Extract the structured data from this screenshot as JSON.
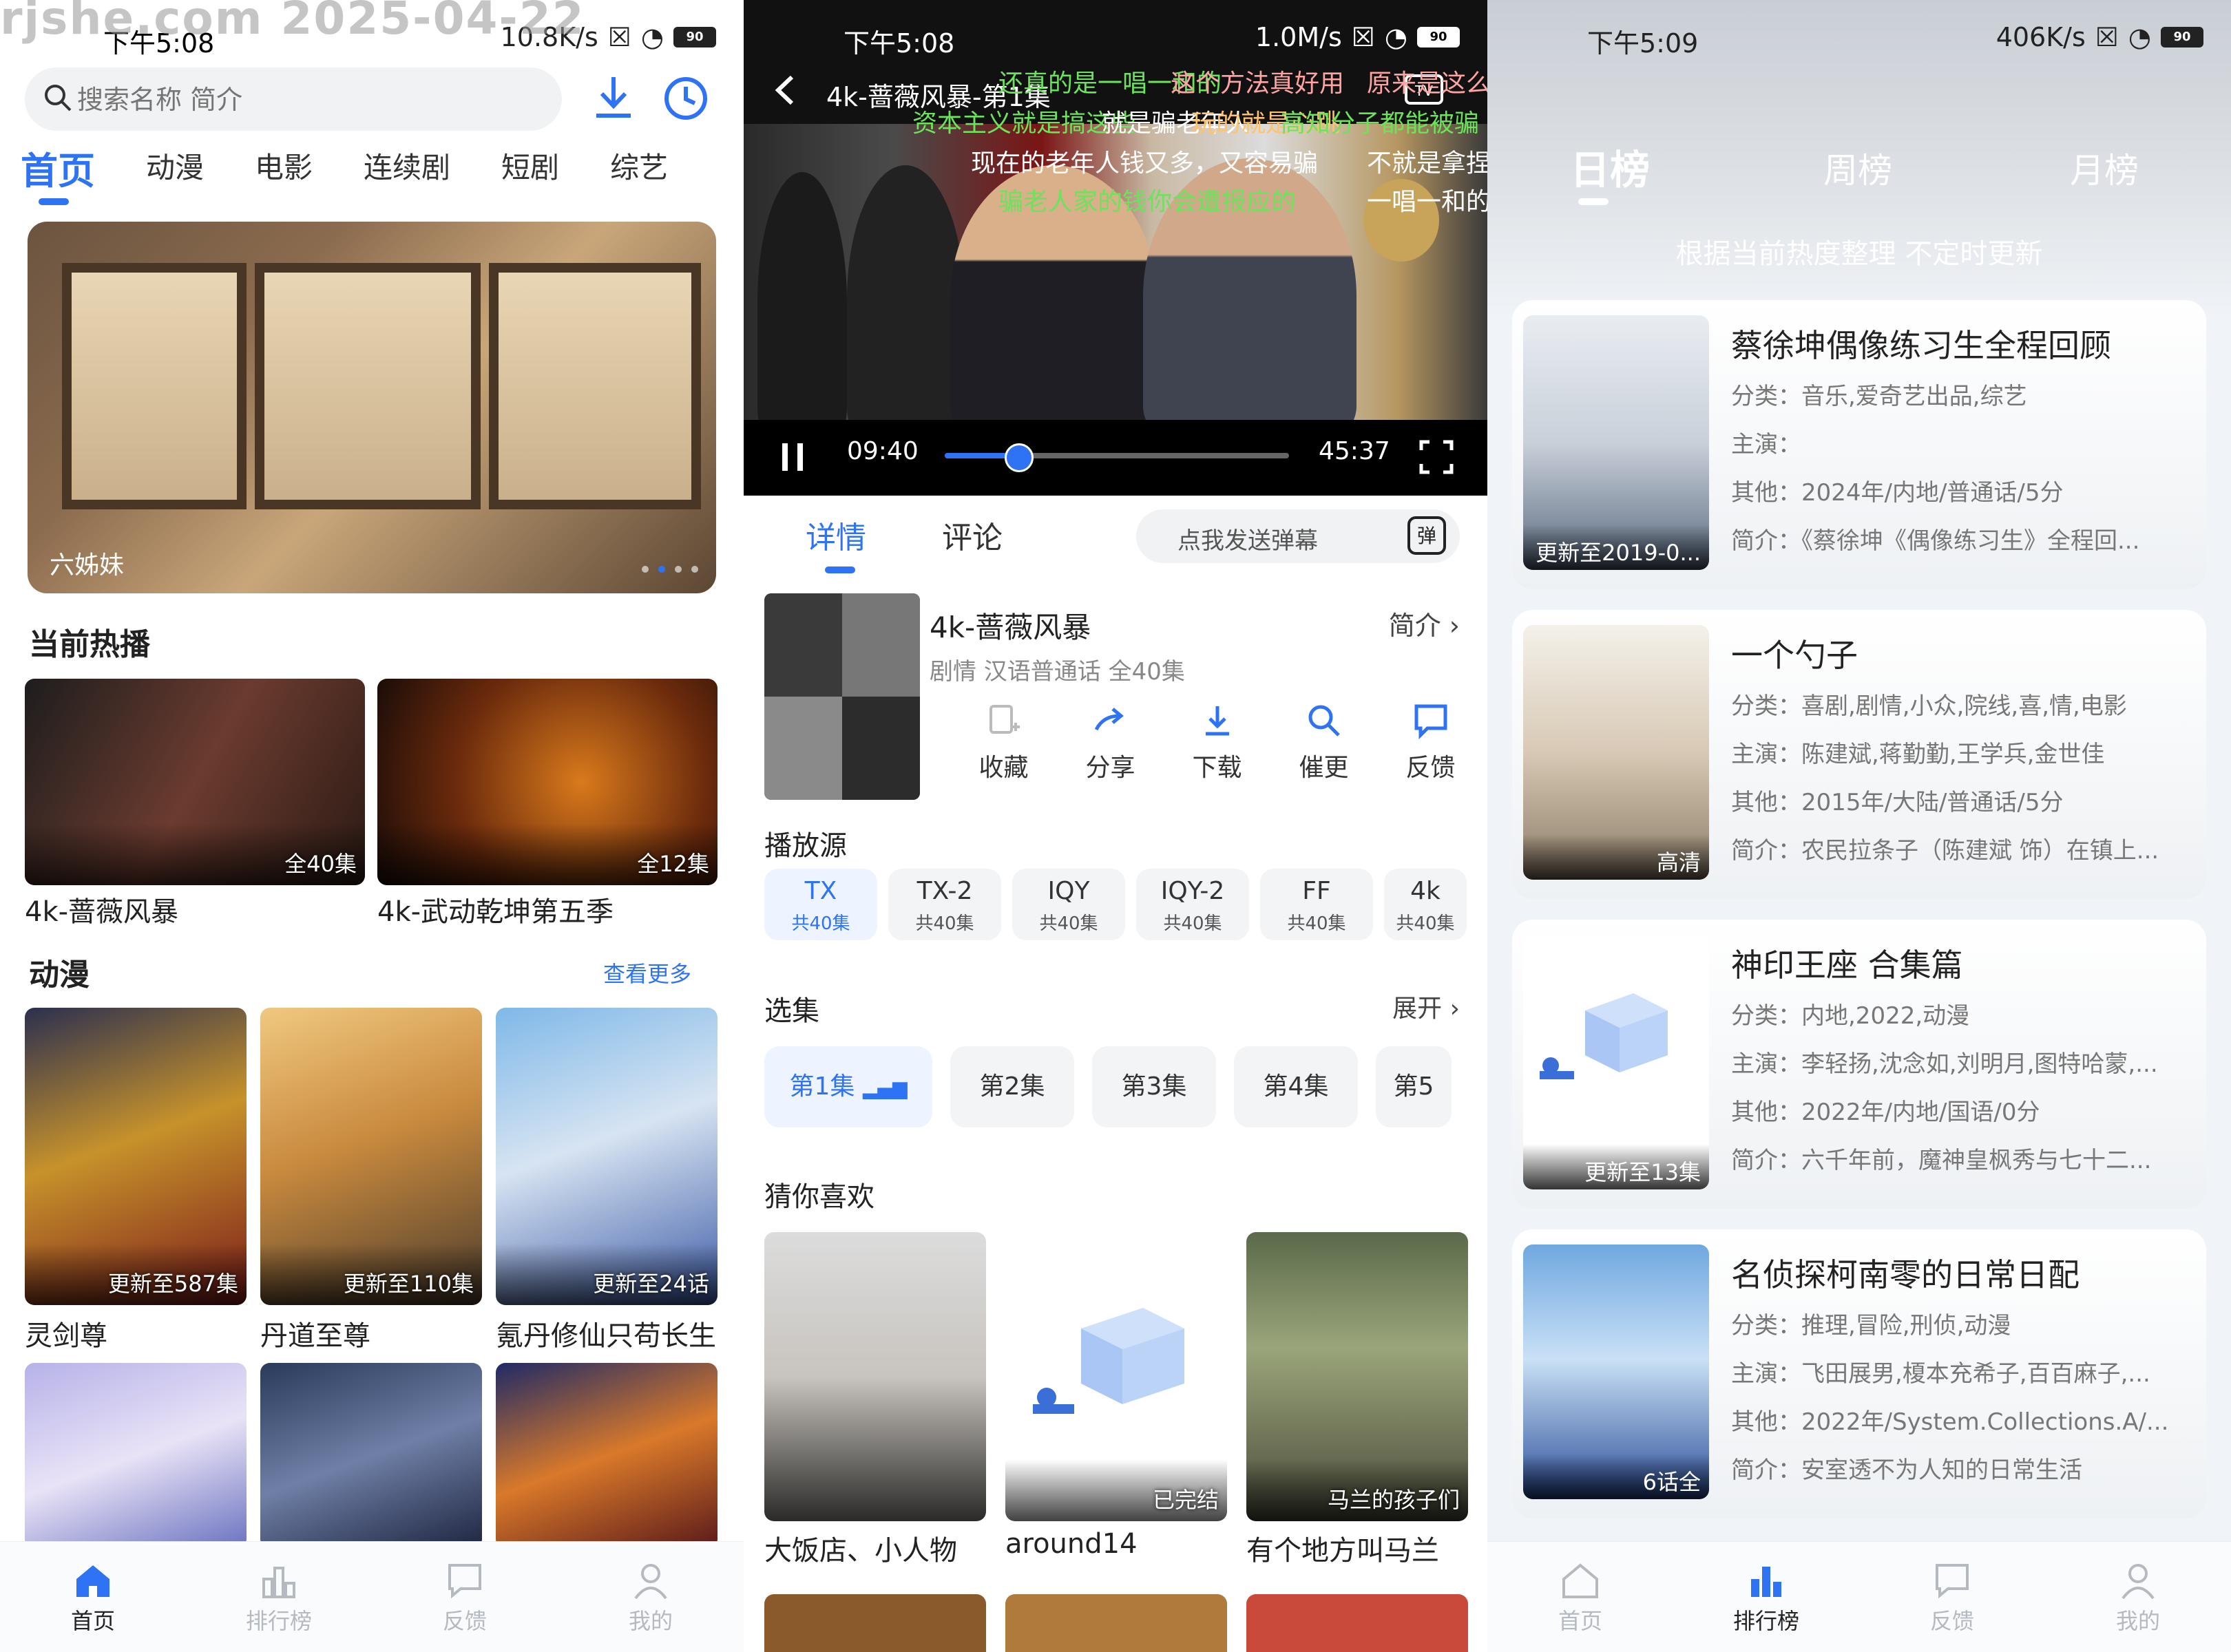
{
  "watermark": "rjshe.com 2025-04-22",
  "screen1": {
    "status": {
      "time": "下午5:08",
      "speed": "10.8K/s",
      "battery": "90"
    },
    "search": {
      "placeholder": "搜索名称 简介"
    },
    "categories": [
      "首页",
      "动漫",
      "电影",
      "连续剧",
      "短剧",
      "综艺"
    ],
    "banner": {
      "caption": "六姊妹"
    },
    "hot": {
      "title": "当前热播",
      "items": [
        {
          "title": "4k-蔷薇风暴",
          "badge": "全40集"
        },
        {
          "title": "4k-武动乾坤第五季",
          "badge": "全12集"
        }
      ]
    },
    "anime": {
      "title": "动漫",
      "more": "查看更多",
      "items": [
        {
          "title": "灵剑尊",
          "badge": "更新至587集"
        },
        {
          "title": "丹道至尊",
          "badge": "更新至110集"
        },
        {
          "title": "氪丹修仙只苟长生",
          "badge": "更新至24话"
        }
      ]
    },
    "nav": [
      "首页",
      "排行榜",
      "反馈",
      "我的"
    ]
  },
  "screen2": {
    "status": {
      "time": "下午5:08",
      "speed": "1.0M/s",
      "battery": "90"
    },
    "player": {
      "title": "4k-蔷薇风暴-第1集",
      "current": "09:40",
      "total": "45:37",
      "progress": 0.21,
      "danmaku": [
        "还真的是一唱一和的",
        "原来是这么",
        "这个方法真好用",
        "资本主义就是搞这些",
        "就是骗老年人",
        "玩的就是心跳",
        "高知分子都能被骗",
        "现在的老年人钱又多，又容易骗",
        "不就是拿捏",
        "骗老人家的钱你会遭报应的",
        "一唱一和的"
      ]
    },
    "tabs": [
      "详情",
      "评论"
    ],
    "danmaku_input": {
      "placeholder": "点我发送弹幕",
      "icon_label": "弹"
    },
    "show": {
      "title": "4k-蔷薇风暴",
      "meta": "剧情 汉语普通话 全40集",
      "intro_label": "简介"
    },
    "actions": [
      "收藏",
      "分享",
      "下载",
      "催更",
      "反馈"
    ],
    "sources_title": "播放源",
    "sources": [
      {
        "name": "TX",
        "count": "共40集"
      },
      {
        "name": "TX-2",
        "count": "共40集"
      },
      {
        "name": "IQY",
        "count": "共40集"
      },
      {
        "name": "IQY-2",
        "count": "共40集"
      },
      {
        "name": "FF",
        "count": "共40集"
      },
      {
        "name": "4k",
        "count": "共40集"
      }
    ],
    "episodes_title": "选集",
    "expand_label": "展开",
    "episodes": [
      "第1集",
      "第2集",
      "第3集",
      "第4集",
      "第5"
    ],
    "recommend": {
      "title": "猜你喜欢",
      "items": [
        {
          "title": "大饭店、小人物",
          "badge": ""
        },
        {
          "title": "around14",
          "badge": "已完结"
        },
        {
          "title": "有个地方叫马兰",
          "badge": "马兰的孩子们"
        }
      ]
    }
  },
  "screen3": {
    "status": {
      "time": "下午5:09",
      "speed": "406K/s",
      "battery": "90"
    },
    "tabs": [
      "日榜",
      "周榜",
      "月榜"
    ],
    "subtitle": "根据当前热度整理 不定时更新",
    "items": [
      {
        "title": "蔡徐坤偶像练习生全程回顾",
        "badge": "更新至2019-0...",
        "category": "分类：音乐,爱奇艺出品,综艺",
        "cast": "主演：",
        "other": "其他：2024年/内地/普通话/5分",
        "summary": "简介：《蔡徐坤《偶像练习生》全程回..."
      },
      {
        "title": "一个勺子",
        "badge": "高清",
        "category": "分类：喜剧,剧情,小众,院线,喜,情,电影",
        "cast": "主演：陈建斌,蒋勤勤,王学兵,金世佳",
        "other": "其他：2015年/大陆/普通话/5分",
        "summary": "简介：农民拉条子（陈建斌 饰）在镇上..."
      },
      {
        "title": "神印王座 合集篇",
        "badge": "更新至13集",
        "category": "分类：内地,2022,动漫",
        "cast": "主演：李轻扬,沈念如,刘明月,图特哈蒙,...",
        "other": "其他：2022年/内地/国语/0分",
        "summary": "简介：六千年前，魔神皇枫秀与七十二..."
      },
      {
        "title": "名侦探柯南零的日常日配",
        "badge": "6话全",
        "category": "分类：推理,冒险,刑侦,动漫",
        "cast": "主演：飞田展男,榎本充希子,百百麻子,...",
        "other": "其他：2022年/System.Collections.A/...",
        "summary": "简介：安室透不为人知的日常生活"
      }
    ],
    "nav": [
      "首页",
      "排行榜",
      "反馈",
      "我的"
    ]
  },
  "colors": {
    "accent": "#2f73f5",
    "text": "#222222",
    "muted": "#888888"
  }
}
